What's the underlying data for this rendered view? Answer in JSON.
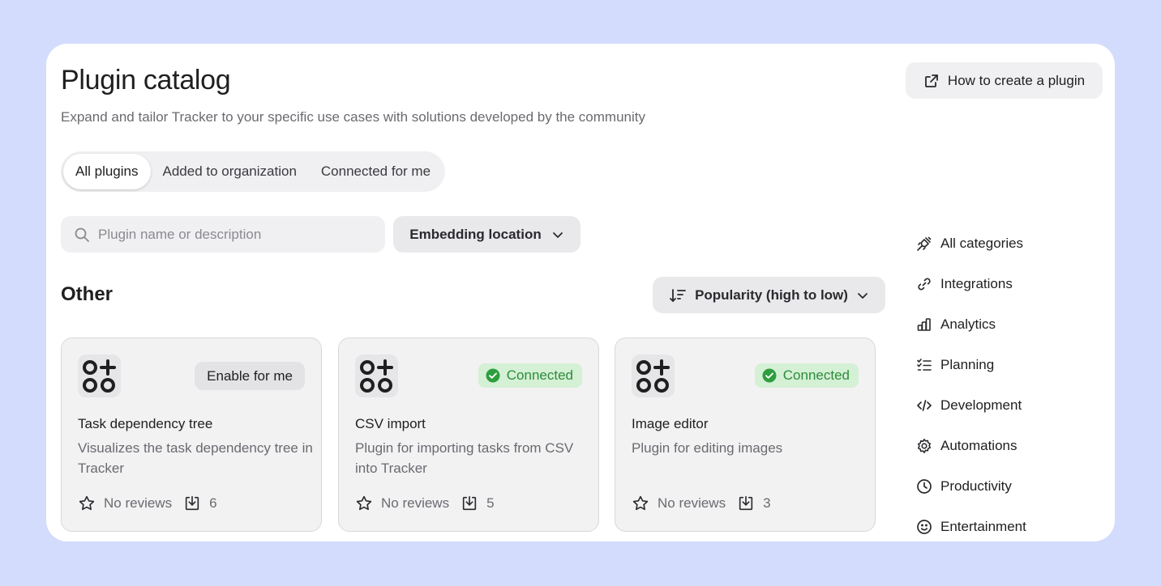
{
  "header": {
    "title": "Plugin catalog",
    "subtitle": "Expand and tailor Tracker to your specific use cases with solutions developed by the community",
    "howto_label": "How to create a plugin"
  },
  "tabs": [
    {
      "label": "All plugins",
      "active": true
    },
    {
      "label": "Added to organization",
      "active": false
    },
    {
      "label": "Connected for me",
      "active": false
    }
  ],
  "search": {
    "placeholder": "Plugin name or description",
    "value": ""
  },
  "filters": {
    "embedding_label": "Embedding location"
  },
  "section": {
    "title": "Other",
    "sort_label": "Popularity (high to low)"
  },
  "cards": [
    {
      "name": "Task dependency tree",
      "description": "Visualizes the task dependency tree in Tracker",
      "action": "Enable for me",
      "reviews": "No reviews",
      "installs": "6"
    },
    {
      "name": "CSV import",
      "description": "Plugin for importing tasks from CSV into Tracker",
      "status": "Connected",
      "reviews": "No reviews",
      "installs": "5"
    },
    {
      "name": "Image editor",
      "description": "Plugin for editing images",
      "status": "Connected",
      "reviews": "No reviews",
      "installs": "3"
    }
  ],
  "categories": [
    {
      "label": "All categories",
      "icon": "plug-icon"
    },
    {
      "label": "Integrations",
      "icon": "link-icon"
    },
    {
      "label": "Analytics",
      "icon": "bar-chart-icon"
    },
    {
      "label": "Planning",
      "icon": "checklist-icon"
    },
    {
      "label": "Development",
      "icon": "code-icon"
    },
    {
      "label": "Automations",
      "icon": "gear-icon"
    },
    {
      "label": "Productivity",
      "icon": "clock-icon"
    },
    {
      "label": "Entertainment",
      "icon": "smile-icon"
    }
  ],
  "colors": {
    "background": "#d3dcfc",
    "panel": "#ffffff",
    "connected_bg": "#d4f0d5",
    "connected_text": "#2e8b3a",
    "muted_text": "#6a6a70"
  }
}
